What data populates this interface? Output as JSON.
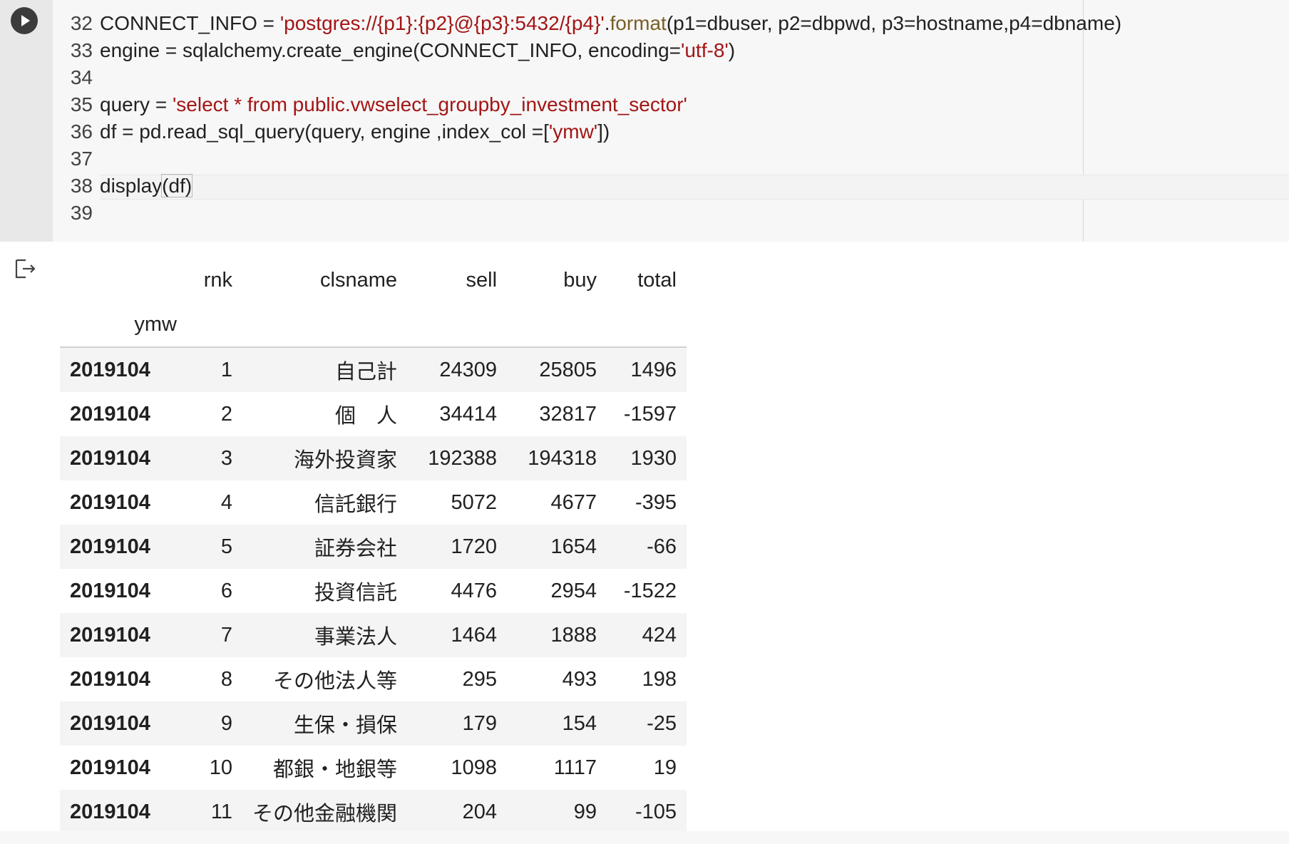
{
  "code": {
    "lines": [
      {
        "num": "32",
        "parts": [
          {
            "t": "k",
            "v": "CONNECT_INFO = "
          },
          {
            "t": "s",
            "v": "'postgres://{p1}:{p2}@{p3}:5432/{p4}'"
          },
          {
            "t": "k",
            "v": "."
          },
          {
            "t": "f",
            "v": "format"
          },
          {
            "t": "k",
            "v": "(p1=dbuser, p2=dbpwd, p3=hostname,p4=dbname)"
          }
        ]
      },
      {
        "num": "33",
        "parts": [
          {
            "t": "k",
            "v": "engine = sqlalchemy.create_engine(CONNECT_INFO, encoding="
          },
          {
            "t": "s",
            "v": "'utf-8'"
          },
          {
            "t": "k",
            "v": ")"
          }
        ]
      },
      {
        "num": "34",
        "parts": []
      },
      {
        "num": "35",
        "parts": [
          {
            "t": "k",
            "v": "query = "
          },
          {
            "t": "s",
            "v": "'select * from public.vwselect_groupby_investment_sector'"
          }
        ]
      },
      {
        "num": "36",
        "parts": [
          {
            "t": "k",
            "v": "df = pd.read_sql_query(query, engine ,index_col =["
          },
          {
            "t": "s",
            "v": "'ymw'"
          },
          {
            "t": "k",
            "v": "])"
          }
        ]
      },
      {
        "num": "37",
        "parts": []
      },
      {
        "num": "38",
        "parts": [
          {
            "t": "k",
            "v": "display"
          },
          {
            "t": "hl",
            "v": "(df)"
          }
        ]
      },
      {
        "num": "39",
        "parts": []
      }
    ]
  },
  "output": {
    "columns": [
      "rnk",
      "clsname",
      "sell",
      "buy",
      "total"
    ],
    "index_name": "ymw",
    "rows": [
      [
        "2019104",
        "1",
        "自己計",
        "24309",
        "25805",
        "1496"
      ],
      [
        "2019104",
        "2",
        "個　人",
        "34414",
        "32817",
        "-1597"
      ],
      [
        "2019104",
        "3",
        "海外投資家",
        "192388",
        "194318",
        "1930"
      ],
      [
        "2019104",
        "4",
        "信託銀行",
        "5072",
        "4677",
        "-395"
      ],
      [
        "2019104",
        "5",
        "証券会社",
        "1720",
        "1654",
        "-66"
      ],
      [
        "2019104",
        "6",
        "投資信託",
        "4476",
        "2954",
        "-1522"
      ],
      [
        "2019104",
        "7",
        "事業法人",
        "1464",
        "1888",
        "424"
      ],
      [
        "2019104",
        "8",
        "その他法人等",
        "295",
        "493",
        "198"
      ],
      [
        "2019104",
        "9",
        "生保・損保",
        "179",
        "154",
        "-25"
      ],
      [
        "2019104",
        "10",
        "都銀・地銀等",
        "1098",
        "1117",
        "19"
      ],
      [
        "2019104",
        "11",
        "その他金融機関",
        "204",
        "99",
        "-105"
      ]
    ]
  },
  "icons": {
    "run": "play-icon",
    "output": "output-icon"
  },
  "colors": {
    "string": "#a31515",
    "function": "#795e26",
    "gutter": "#e8e8e8",
    "editor_bg": "#f7f7f7"
  }
}
